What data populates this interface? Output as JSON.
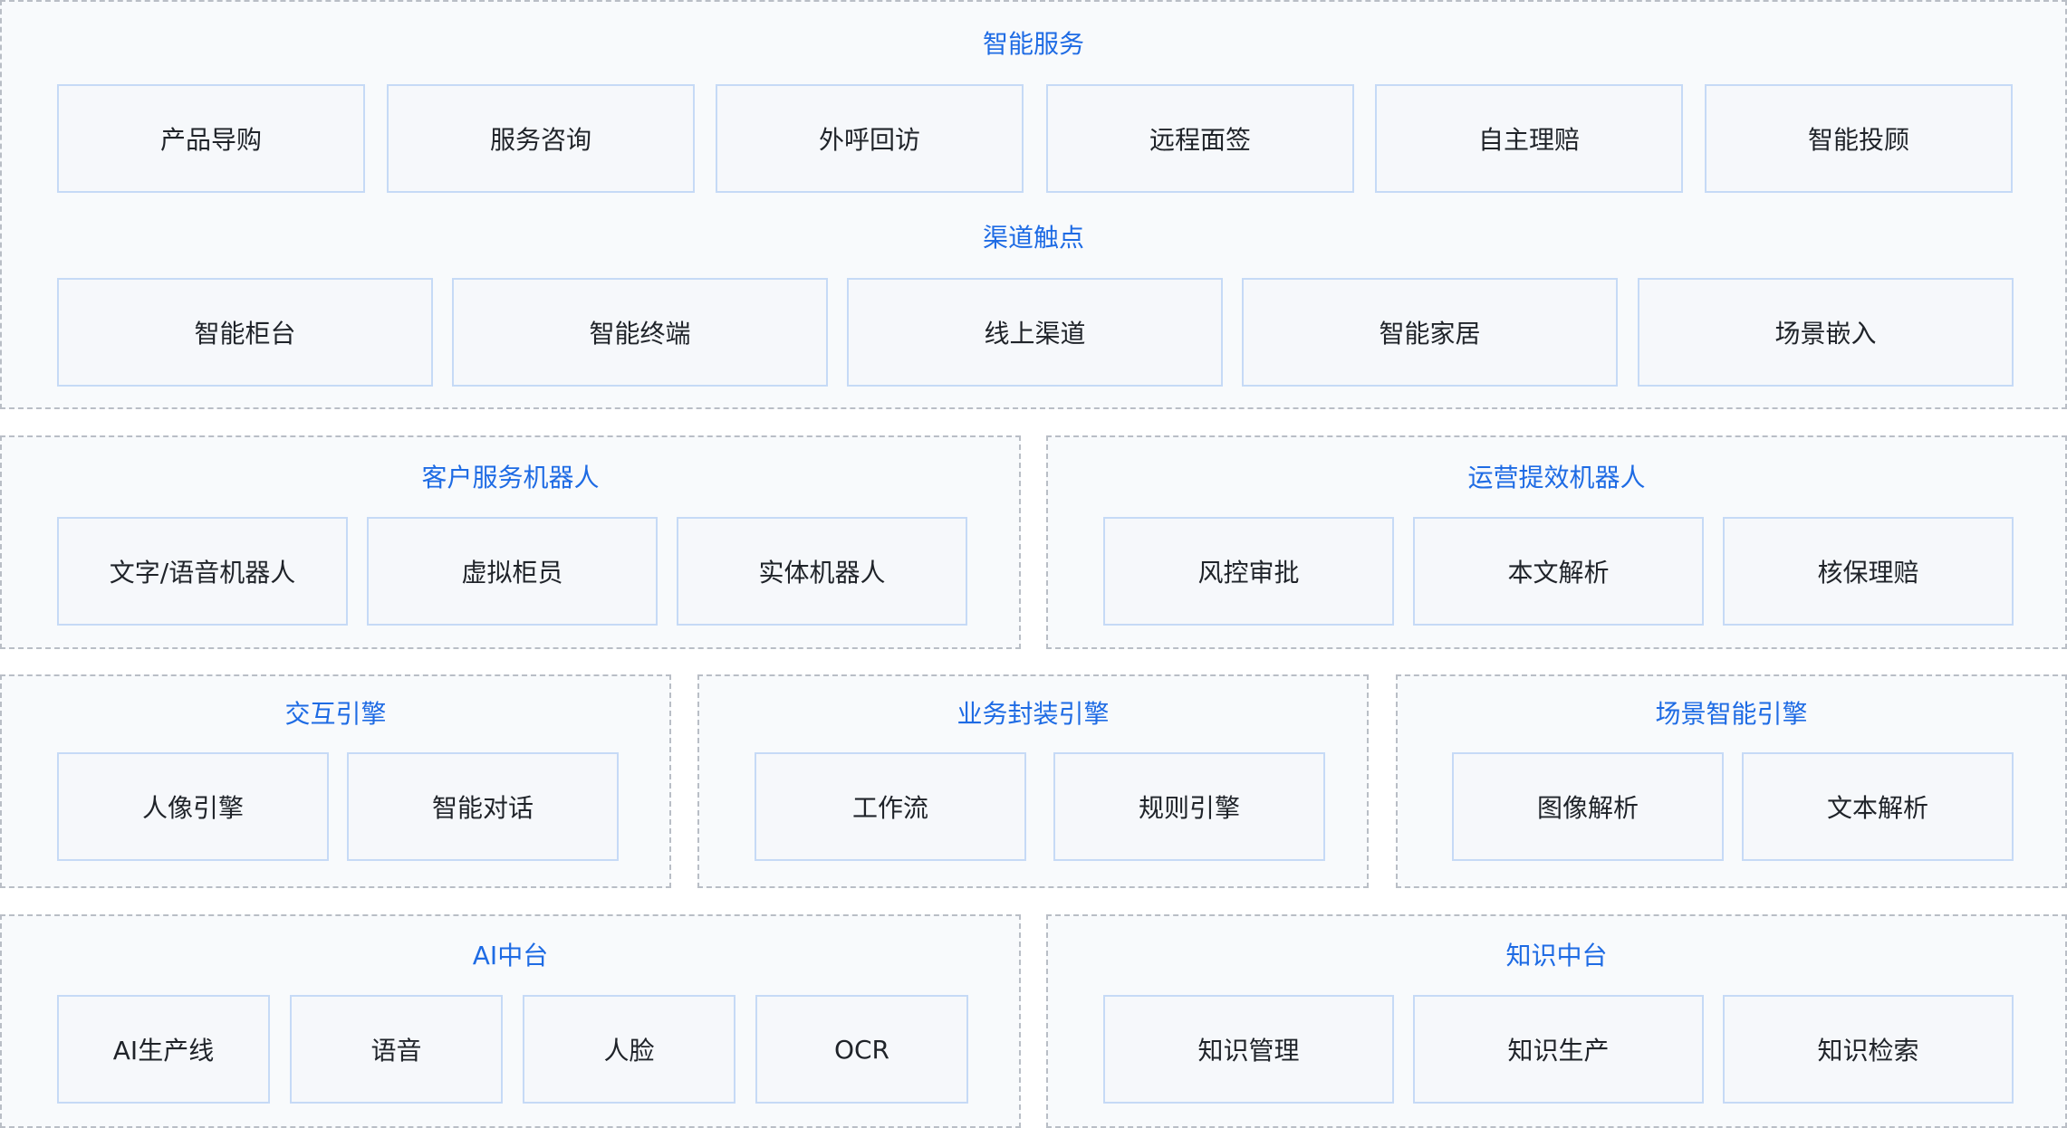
{
  "colors": {
    "accent": "#1e6be4",
    "box_border": "#c6daf6",
    "box_fill": "#f6f8fb",
    "panel_border": "#b9bec6",
    "panel_fill": "#f8fafc",
    "text": "#1f2329"
  },
  "top": {
    "service_title": "智能服务",
    "services": [
      "产品导购",
      "服务咨询",
      "外呼回访",
      "远程面签",
      "自主理赔",
      "智能投顾"
    ],
    "channel_title": "渠道触点",
    "channels": [
      "智能柜台",
      "智能终端",
      "线上渠道",
      "智能家居",
      "场景嵌入"
    ]
  },
  "robots": {
    "customer": {
      "title": "客户服务机器人",
      "items": [
        "文字/语音机器人",
        "虚拟柜员",
        "实体机器人"
      ]
    },
    "operation": {
      "title": "运营提效机器人",
      "items": [
        "风控审批",
        "本文解析",
        "核保理赔"
      ]
    }
  },
  "engines": {
    "interaction": {
      "title": "交互引擎",
      "items": [
        "人像引擎",
        "智能对话"
      ]
    },
    "business": {
      "title": "业务封装引擎",
      "items": [
        "工作流",
        "规则引擎"
      ]
    },
    "scene": {
      "title": "场景智能引擎",
      "items": [
        "图像解析",
        "文本解析"
      ]
    }
  },
  "platforms": {
    "ai": {
      "title": "AI中台",
      "items": [
        "AI生产线",
        "语音",
        "人脸",
        "OCR"
      ]
    },
    "knowledge": {
      "title": "知识中台",
      "items": [
        "知识管理",
        "知识生产",
        "知识检索"
      ]
    }
  }
}
